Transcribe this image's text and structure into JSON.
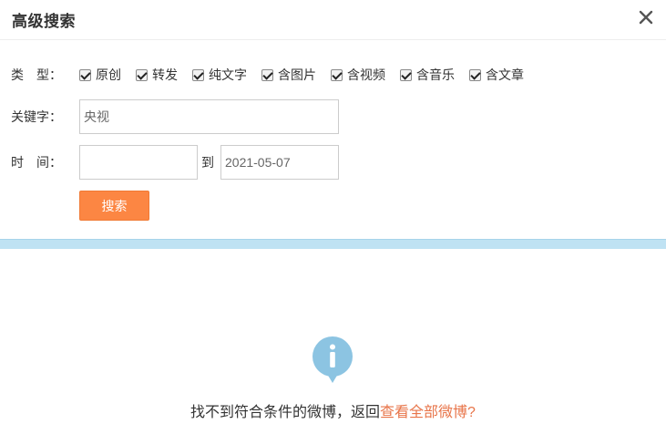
{
  "dialog": {
    "title": "高级搜索",
    "close_icon": "close-icon"
  },
  "form": {
    "type_label": "类　型：",
    "types": [
      {
        "label": "原创",
        "checked": true
      },
      {
        "label": "转发",
        "checked": true
      },
      {
        "label": "纯文字",
        "checked": true
      },
      {
        "label": "含图片",
        "checked": true
      },
      {
        "label": "含视频",
        "checked": true
      },
      {
        "label": "含音乐",
        "checked": true
      },
      {
        "label": "含文章",
        "checked": true
      }
    ],
    "keyword_label": "关键字：",
    "keyword_value": "央视",
    "time_label": "时　间：",
    "time_from_value": "",
    "to_label": "到",
    "time_to_value": "2021-05-07",
    "search_button": "搜索"
  },
  "empty_state": {
    "icon": "info-icon",
    "message": "找不到符合条件的微博，返回",
    "link_text": "查看全部微博?"
  },
  "colors": {
    "accent_button": "#fc8643",
    "band": "#bfe2f3",
    "info_icon": "#8cc4e2",
    "link": "#e8754a"
  }
}
